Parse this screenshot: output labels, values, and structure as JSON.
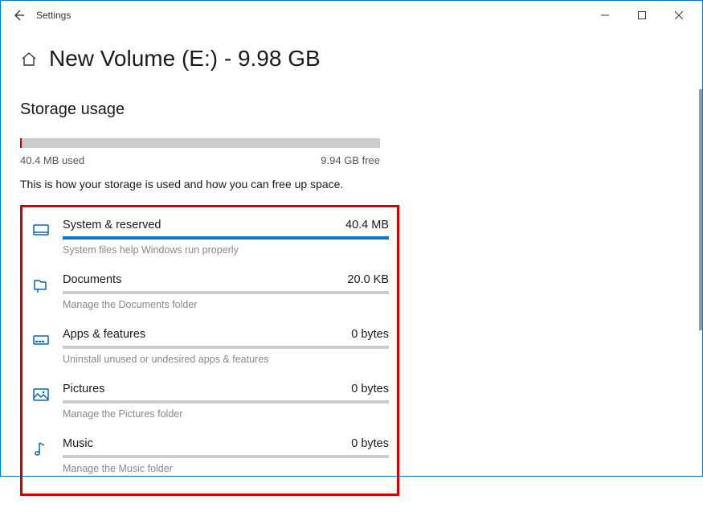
{
  "app_title": "Settings",
  "page_title": "New Volume (E:) - 9.98 GB",
  "section_title": "Storage usage",
  "used_label": "40.4 MB used",
  "free_label": "9.94 GB free",
  "description": "This is how your storage is used and how you can free up space.",
  "overall_fill_percent": 0.4,
  "categories": [
    {
      "name": "System & reserved",
      "size": "40.4 MB",
      "sub": "System files help Windows run properly",
      "fill_percent": 100
    },
    {
      "name": "Documents",
      "size": "20.0 KB",
      "sub": "Manage the Documents folder",
      "fill_percent": 0
    },
    {
      "name": "Apps & features",
      "size": "0 bytes",
      "sub": "Uninstall unused or undesired apps & features",
      "fill_percent": 0
    },
    {
      "name": "Pictures",
      "size": "0 bytes",
      "sub": "Manage the Pictures folder",
      "fill_percent": 0
    },
    {
      "name": "Music",
      "size": "0 bytes",
      "sub": "Manage the Music folder",
      "fill_percent": 0
    }
  ]
}
